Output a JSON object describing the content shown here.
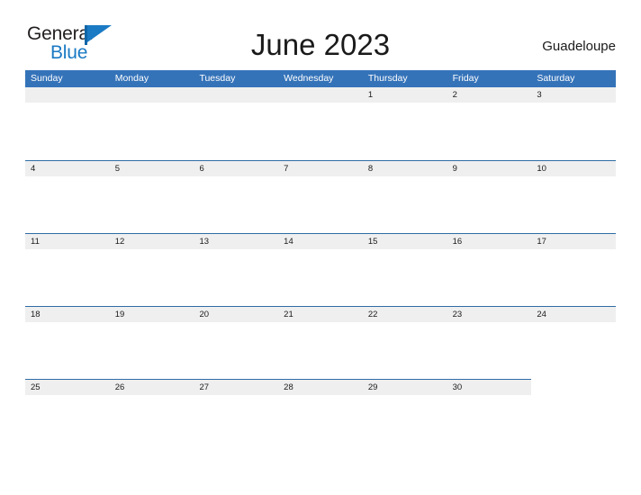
{
  "brand": {
    "name_part1": "General",
    "name_part2": "Blue",
    "flag_icon": "flag-triangle-icon",
    "color_dark": "#231f20",
    "color_blue": "#1b7ac4"
  },
  "header": {
    "title": "June 2023",
    "region": "Guadeloupe"
  },
  "theme": {
    "header_blue": "#3573b9",
    "rule_blue": "#2e6da4",
    "strip_gray": "#efefef",
    "page_background": "#ffffff"
  },
  "calendar": {
    "month": "June",
    "year": "2023",
    "weekday_headers": [
      "Sunday",
      "Monday",
      "Tuesday",
      "Wednesday",
      "Thursday",
      "Friday",
      "Saturday"
    ],
    "weeks": [
      {
        "filled_columns": 7,
        "days": [
          "",
          "",
          "",
          "",
          "1",
          "2",
          "3"
        ]
      },
      {
        "filled_columns": 7,
        "days": [
          "4",
          "5",
          "6",
          "7",
          "8",
          "9",
          "10"
        ]
      },
      {
        "filled_columns": 7,
        "days": [
          "11",
          "12",
          "13",
          "14",
          "15",
          "16",
          "17"
        ]
      },
      {
        "filled_columns": 7,
        "days": [
          "18",
          "19",
          "20",
          "21",
          "22",
          "23",
          "24"
        ]
      },
      {
        "filled_columns": 6,
        "days": [
          "25",
          "26",
          "27",
          "28",
          "29",
          "30",
          ""
        ]
      }
    ]
  }
}
